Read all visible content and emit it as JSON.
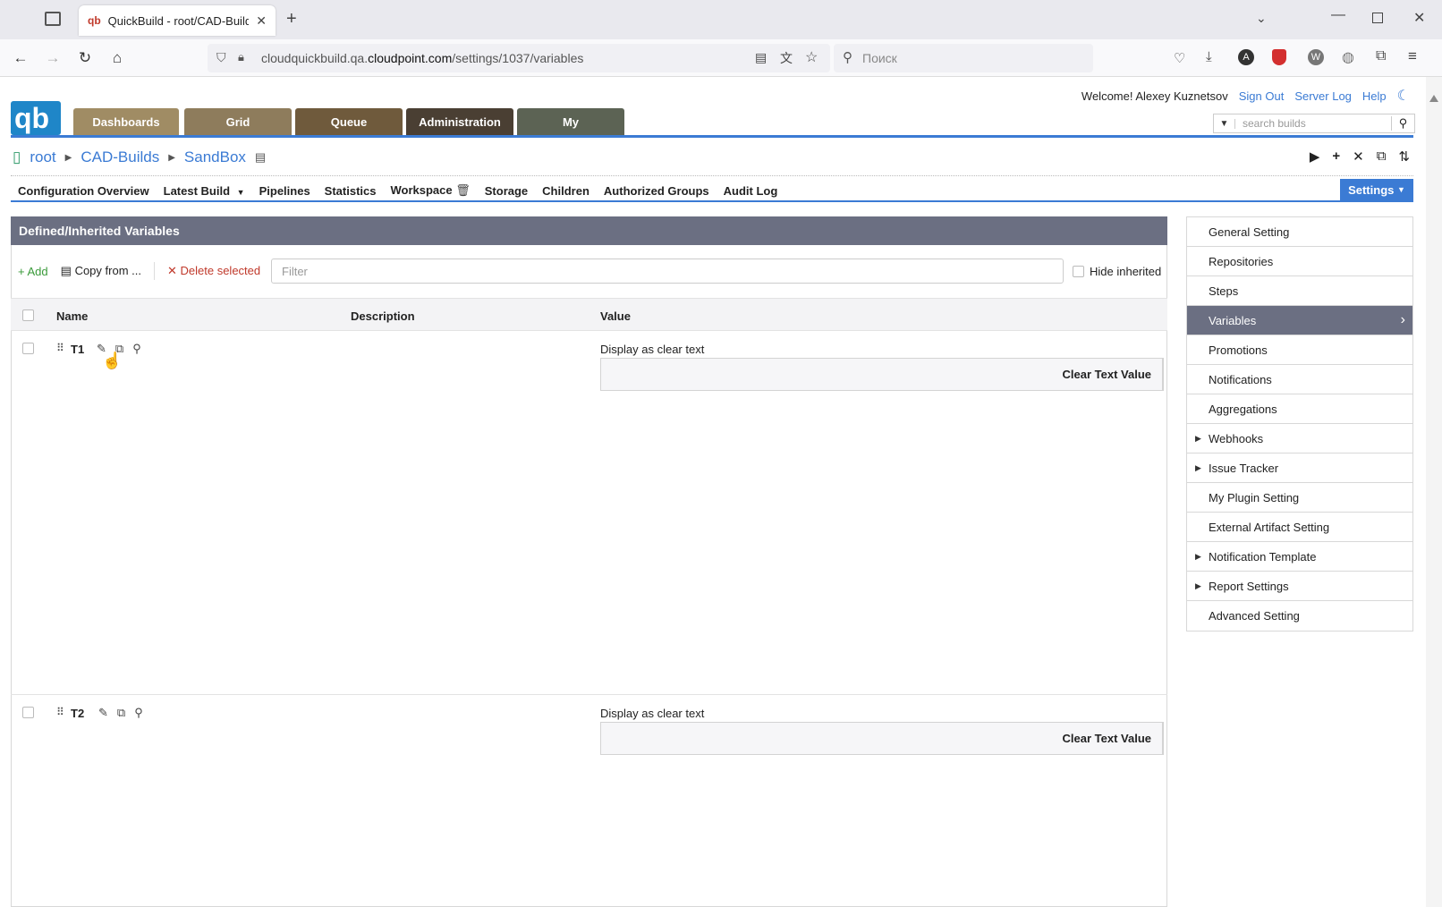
{
  "browser": {
    "tab_title": "QuickBuild - root/CAD-Builds/S",
    "url_prefix": "cloudquickbuild.qa.",
    "url_host": "cloudpoint.com",
    "url_path": "/settings/1037/variables",
    "search_placeholder": "Поиск"
  },
  "header": {
    "welcome": "Welcome! Alexey Kuznetsov",
    "sign_out": "Sign Out",
    "server_log": "Server Log",
    "help": "Help",
    "search_builds_placeholder": "search builds",
    "nav": [
      {
        "label": "Dashboards",
        "color": "#a08c64"
      },
      {
        "label": "Grid",
        "color": "#8e7c5c"
      },
      {
        "label": "Queue",
        "color": "#6f5a3c"
      },
      {
        "label": "Administration",
        "color": "#4a3f33"
      },
      {
        "label": "My",
        "color": "#5c6354"
      }
    ]
  },
  "breadcrumb": [
    "root",
    "CAD-Builds",
    "SandBox"
  ],
  "subnav": {
    "items": [
      "Configuration Overview",
      "Latest Build",
      "Pipelines",
      "Statistics",
      "Workspace",
      "Storage",
      "Children",
      "Authorized Groups",
      "Audit Log"
    ],
    "settings": "Settings"
  },
  "panel": {
    "title": "Defined/Inherited Variables",
    "add": "Add",
    "copy_from": "Copy from ...",
    "delete_selected": "Delete selected",
    "filter_placeholder": "Filter",
    "hide_inherited": "Hide inherited",
    "columns": {
      "name": "Name",
      "description": "Description",
      "value": "Value"
    },
    "variables": [
      {
        "name": "T1",
        "mode": "Display as clear text",
        "value_button": "Clear Text Value"
      },
      {
        "name": "T2",
        "mode": "Display as clear text",
        "value_button": "Clear Text Value"
      }
    ]
  },
  "sidebar": {
    "items": [
      {
        "label": "General Setting",
        "expandable": false
      },
      {
        "label": "Repositories",
        "expandable": false
      },
      {
        "label": "Steps",
        "expandable": false
      },
      {
        "label": "Variables",
        "expandable": false,
        "active": true
      },
      {
        "label": "Promotions",
        "expandable": false
      },
      {
        "label": "Notifications",
        "expandable": false
      },
      {
        "label": "Aggregations",
        "expandable": false
      },
      {
        "label": "Webhooks",
        "expandable": true
      },
      {
        "label": "Issue Tracker",
        "expandable": true
      },
      {
        "label": "My Plugin Setting",
        "expandable": false
      },
      {
        "label": "External Artifact Setting",
        "expandable": false
      },
      {
        "label": "Notification Template",
        "expandable": true
      },
      {
        "label": "Report Settings",
        "expandable": true
      },
      {
        "label": "Advanced Setting",
        "expandable": false
      }
    ]
  },
  "colors": {
    "accent": "#3b7bd4",
    "panel_header": "#6b6f82",
    "danger": "#c0392b",
    "add_green": "#3a9a3a"
  }
}
